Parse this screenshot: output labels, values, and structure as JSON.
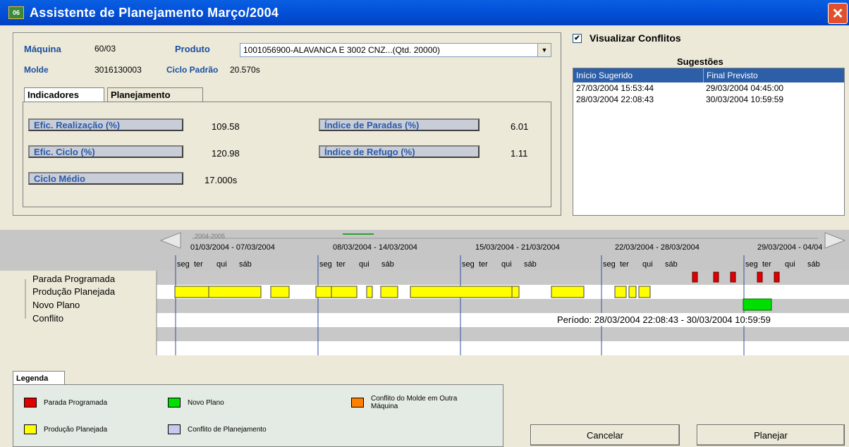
{
  "window": {
    "title": "Assistente de Planejamento Março/2004",
    "close": "✕"
  },
  "header": {
    "maquina_label": "Máquina",
    "maquina_value": "60/03",
    "produto_label": "Produto",
    "produto_value": "1001056900-ALAVANCA E 3002 CNZ...(Qtd. 20000)",
    "molde_label": "Molde",
    "molde_value": "3016130003",
    "ciclo_label": "Ciclo Padrão",
    "ciclo_value": "20.570s"
  },
  "tabs": [
    {
      "label": "Indicadores"
    },
    {
      "label": "Planejamento"
    }
  ],
  "indicators": {
    "efic_realizacao": {
      "label": "Efic. Realização (%)",
      "value": "109.58"
    },
    "indice_paradas": {
      "label": "Índice de Paradas (%)",
      "value": "6.01"
    },
    "efic_ciclo": {
      "label": "Efic. Ciclo (%)",
      "value": "120.98"
    },
    "indice_refugo": {
      "label": "Índice de Refugo (%)",
      "value": "1.11"
    },
    "ciclo_medio": {
      "label": "Ciclo Médio",
      "value": "17.000s"
    }
  },
  "conflicts": {
    "checkbox_label": "Visualizar Conflitos",
    "checked_glyph": "✔"
  },
  "suggestions": {
    "title": "Sugestões",
    "columns": [
      "Início Sugerido",
      "Final Previsto"
    ],
    "rows": [
      [
        "27/03/2004 15:53:44",
        "29/03/2004 04:45:00"
      ],
      [
        "28/03/2004 22:08:43",
        "30/03/2004 10:59:59"
      ]
    ]
  },
  "timeline": {
    "year": "2004-2005",
    "weeks": [
      "01/03/2004 - 07/03/2004",
      "08/03/2004 - 14/03/2004",
      "15/03/2004 - 21/03/2004",
      "22/03/2004 - 28/03/2004",
      "29/03/2004 - 04/04"
    ],
    "day_labels": [
      "seg",
      "ter",
      "qui",
      "sáb"
    ],
    "rows": [
      "Parada Programada",
      "Produção Planejada",
      "Novo Plano",
      "Conflito"
    ],
    "tooltip": "Período: 28/03/2004 22:08:43 - 30/03/2004 10:59:59"
  },
  "legend": {
    "tab": "Legenda",
    "items": [
      {
        "label": "Parada Programada",
        "color": "#e00000"
      },
      {
        "label": "Novo Plano",
        "color": "#00e000"
      },
      {
        "label": "Conflito do Molde em Outra Máquina",
        "color": "#ff8000"
      },
      {
        "label": "Produção Planejada",
        "color": "#ffff00"
      },
      {
        "label": "Conflito de Planejamento",
        "color": "#c8c8f0"
      }
    ]
  },
  "buttons": {
    "cancel": "Cancelar",
    "plan": "Planejar"
  }
}
